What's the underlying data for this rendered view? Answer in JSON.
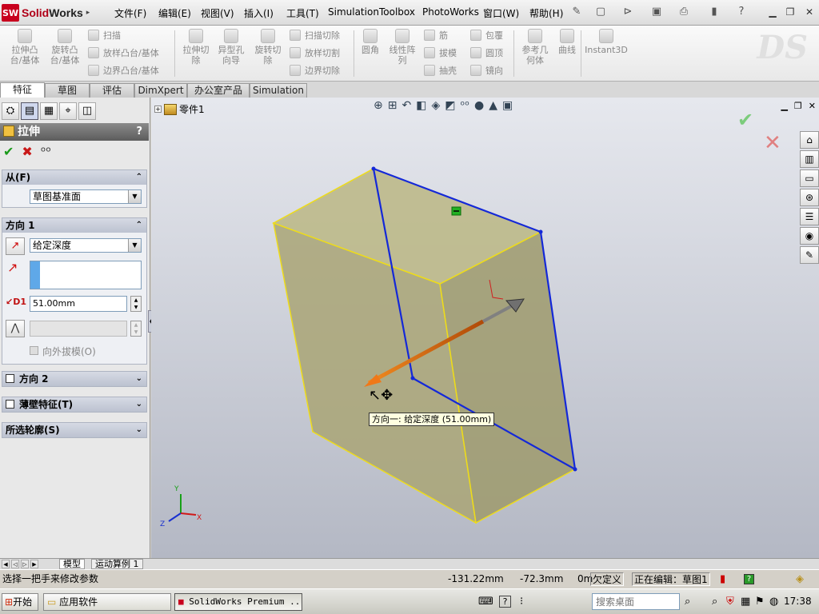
{
  "app": {
    "logo_mark": "SW",
    "logo_brand": "Solid",
    "logo_brand2": "Works"
  },
  "menu": {
    "items": [
      "文件(F)",
      "编辑(E)",
      "视图(V)",
      "插入(I)",
      "工具(T)",
      "Simulation",
      "Toolbox",
      "PhotoWorks",
      "窗口(W)",
      "帮助(H)"
    ]
  },
  "ribbon": {
    "extrude_boss": "拉伸凸\n台/基体",
    "revolve_boss": "旋转凸\n台/基体",
    "sweep": "扫描",
    "loft": "放样凸台/基体",
    "boundary_boss": "边界凸台/基体",
    "extrude_cut": "拉伸切\n除",
    "hole_wizard": "异型孔\n向导",
    "revolve_cut": "旋转切\n除",
    "sweep_cut": "扫描切除",
    "loft_cut": "放样切割",
    "boundary_cut": "边界切除",
    "fillet": "圆角",
    "linear_pattern": "线性阵\n列",
    "rib": "筋",
    "draft": "拔模",
    "shell": "抽壳",
    "wrap": "包覆",
    "dome": "圆顶",
    "mirror": "镜向",
    "ref_geometry": "参考几\n何体",
    "curves": "曲线",
    "instant3d": "Instant3D"
  },
  "tabs": [
    "特征",
    "草图",
    "评估",
    "DimXpert",
    "办公室产品",
    "Simulation"
  ],
  "property_manager": {
    "title": "拉伸",
    "help": "?",
    "from": {
      "header": "从(F)",
      "value": "草图基准面"
    },
    "direction1": {
      "header": "方向 1",
      "end_condition": "给定深度",
      "depth": "51.00mm",
      "draft_outward": "向外拔模(O)"
    },
    "direction2": {
      "header": "方向 2"
    },
    "thin_feature": {
      "header": "薄壁特征(T)"
    },
    "selected_contours": {
      "header": "所选轮廓(S)"
    }
  },
  "graphics": {
    "tree_root": "零件1",
    "tooltip": "方向一: 给定深度 (51.00mm)",
    "triad_x": "X",
    "triad_y": "Y",
    "triad_z": "Z"
  },
  "bottom_tabs": [
    "模型",
    "运动算例 1"
  ],
  "status": {
    "message": "选择一把手来修改参数",
    "x": "-131.22mm",
    "y": "-72.3mm",
    "z": "0m",
    "constraint": "欠定义",
    "editing": "正在编辑：草图1"
  },
  "taskbar": {
    "start": "开始",
    "folder": "应用软件",
    "app": "SolidWorks Premium ...",
    "search_placeholder": "搜索桌面",
    "clock": "17:38"
  },
  "colors": {
    "face_fill": "#b2ae7a",
    "sketch_edge": "#1428d8",
    "body_edge": "#f0e020",
    "arrow": "#e07818"
  }
}
